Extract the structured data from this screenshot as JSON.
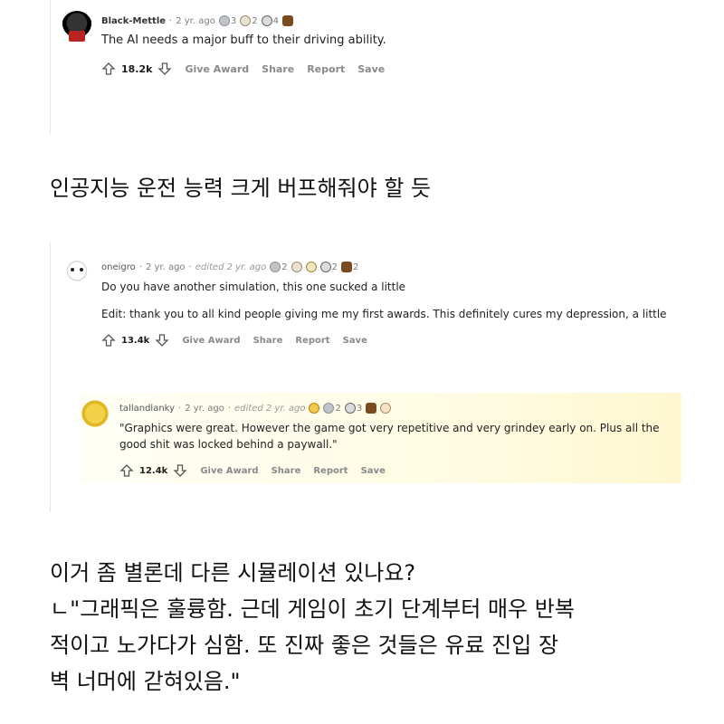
{
  "comment1": {
    "username": "Black-Mettle",
    "age": "2 yr. ago",
    "awards": [
      {
        "icon": "silver-award-icon",
        "count": "3"
      },
      {
        "icon": "helpful-award-icon",
        "count": "2"
      },
      {
        "icon": "dollar-award-icon",
        "count": "4"
      },
      {
        "icon": "bear-award-icon",
        "count": ""
      }
    ],
    "text": "The AI needs a major buff to their driving ability.",
    "votes": "18.2k",
    "actions": {
      "give_award": "Give Award",
      "share": "Share",
      "report": "Report",
      "save": "Save"
    }
  },
  "caption1": "인공지능 운전 능력 크게 버프해줘야 할 듯",
  "comment2": {
    "username": "oneigro",
    "age": "2 yr. ago",
    "edited": "edited 2 yr. ago",
    "awards": [
      {
        "icon": "silver-award-icon",
        "count": "2"
      },
      {
        "icon": "helpful-award-icon",
        "count": ""
      },
      {
        "icon": "wholesome-award-icon",
        "count": ""
      },
      {
        "icon": "dollar-award-icon",
        "count": "2"
      },
      {
        "icon": "bear-award-icon",
        "count": "2"
      }
    ],
    "text": "Do you have another simulation, this one sucked a little",
    "edit_text": "Edit: thank you to all kind people giving me my first awards. This definitely cures my depression, a little",
    "votes": "13.4k",
    "actions": {
      "give_award": "Give Award",
      "share": "Share",
      "report": "Report",
      "save": "Save"
    }
  },
  "comment3": {
    "username": "tallandlanky",
    "age": "2 yr. ago",
    "edited": "edited 2 yr. ago",
    "awards": [
      {
        "icon": "gold-award-icon",
        "count": ""
      },
      {
        "icon": "silver-award-icon",
        "count": "2"
      },
      {
        "icon": "dollar-award-icon",
        "count": "3"
      },
      {
        "icon": "bear-award-icon",
        "count": ""
      },
      {
        "icon": "hand-award-icon",
        "count": ""
      }
    ],
    "text": "\"Graphics were great. However the game got very repetitive and very grindey early on. Plus all the good shit was locked behind a paywall.\"",
    "votes": "12.4k",
    "actions": {
      "give_award": "Give Award",
      "share": "Share",
      "report": "Report",
      "save": "Save"
    }
  },
  "caption2": {
    "line1": "이거 좀 별론데 다른 시뮬레이션 있나요?",
    "line2": "ㄴ\"그래픽은 훌륭함. 근데 게임이 초기 단계부터 매우 반복",
    "line3": "적이고 노가다가 심함. 또 진짜 좋은 것들은 유료 진입 장",
    "line4": "벽 너머에 갇혀있음.\""
  }
}
